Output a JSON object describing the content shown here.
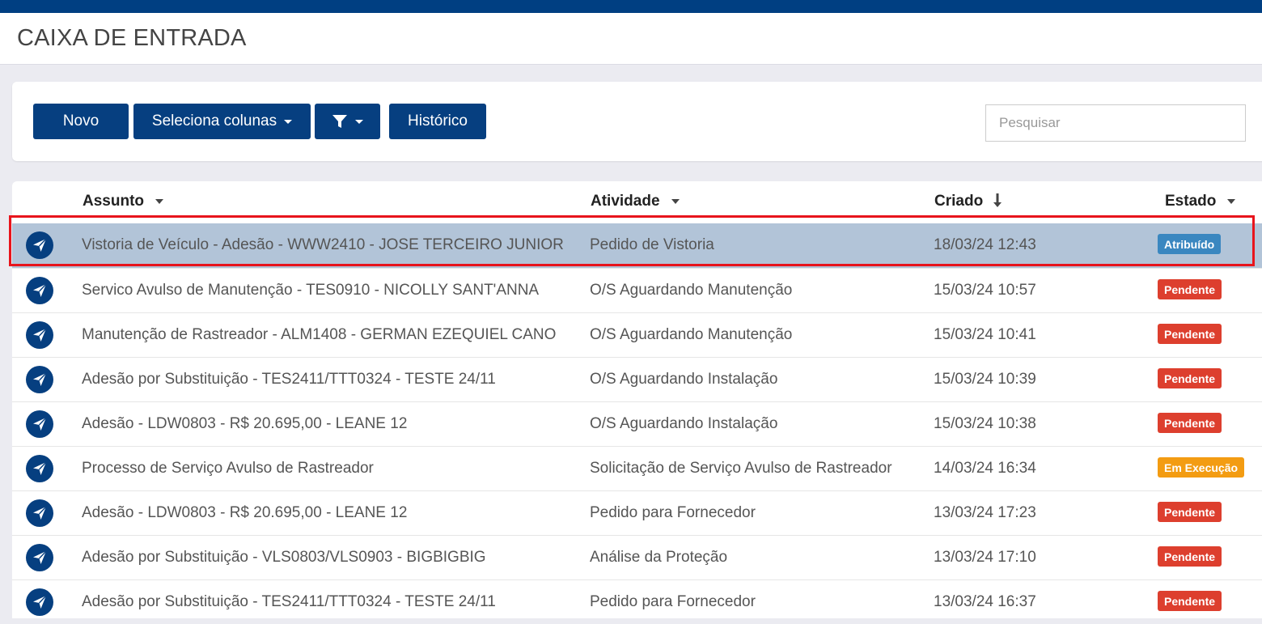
{
  "page": {
    "title": "CAIXA DE ENTRADA"
  },
  "toolbar": {
    "novo_label": "Novo",
    "columns_label": "Seleciona colunas",
    "historico_label": "Histórico",
    "search_placeholder": "Pesquisar"
  },
  "table": {
    "headers": {
      "assunto": "Assunto",
      "atividade": "Atividade",
      "criado": "Criado",
      "estado": "Estado"
    },
    "rows": [
      {
        "assunto": "Vistoria de Veículo - Adesão - WWW2410 - JOSE TERCEIRO JUNIOR",
        "atividade": "Pedido de Vistoria",
        "criado": "18/03/24 12:43",
        "estado": "Atribuído",
        "estado_color": "#3a87c0",
        "selected": true
      },
      {
        "assunto": "Servico Avulso de Manutenção - TES0910 - NICOLLY SANT'ANNA",
        "atividade": "O/S Aguardando Manutenção",
        "criado": "15/03/24 10:57",
        "estado": "Pendente",
        "estado_color": "#dd3f2e"
      },
      {
        "assunto": "Manutenção de Rastreador - ALM1408 - GERMAN EZEQUIEL CANO",
        "atividade": "O/S Aguardando Manutenção",
        "criado": "15/03/24 10:41",
        "estado": "Pendente",
        "estado_color": "#dd3f2e"
      },
      {
        "assunto": "Adesão por Substituição - TES2411/TTT0324 - TESTE 24/11",
        "atividade": "O/S Aguardando Instalação",
        "criado": "15/03/24 10:39",
        "estado": "Pendente",
        "estado_color": "#dd3f2e"
      },
      {
        "assunto": "Adesão - LDW0803 - R$ 20.695,00 - LEANE 12",
        "atividade": "O/S Aguardando Instalação",
        "criado": "15/03/24 10:38",
        "estado": "Pendente",
        "estado_color": "#dd3f2e"
      },
      {
        "assunto": "Processo de Serviço Avulso de Rastreador",
        "atividade": "Solicitação de Serviço Avulso de Rastreador",
        "criado": "14/03/24 16:34",
        "estado": "Em Execução",
        "estado_color": "#f39c12"
      },
      {
        "assunto": "Adesão - LDW0803 - R$ 20.695,00 - LEANE 12",
        "atividade": "Pedido para Fornecedor",
        "criado": "13/03/24 17:23",
        "estado": "Pendente",
        "estado_color": "#dd3f2e"
      },
      {
        "assunto": "Adesão por Substituição - VLS0803/VLS0903 - BIGBIGBIG",
        "atividade": "Análise da Proteção",
        "criado": "13/03/24 17:10",
        "estado": "Pendente",
        "estado_color": "#dd3f2e"
      },
      {
        "assunto": "Adesão por Substituição - TES2411/TTT0324 - TESTE 24/11",
        "atividade": "Pedido para Fornecedor",
        "criado": "13/03/24 16:37",
        "estado": "Pendente",
        "estado_color": "#dd3f2e"
      }
    ]
  },
  "colors": {
    "topbar": "#003f82",
    "button": "#063f80",
    "selected_row": "#b2c4d8",
    "highlight_border": "#e8141c"
  }
}
